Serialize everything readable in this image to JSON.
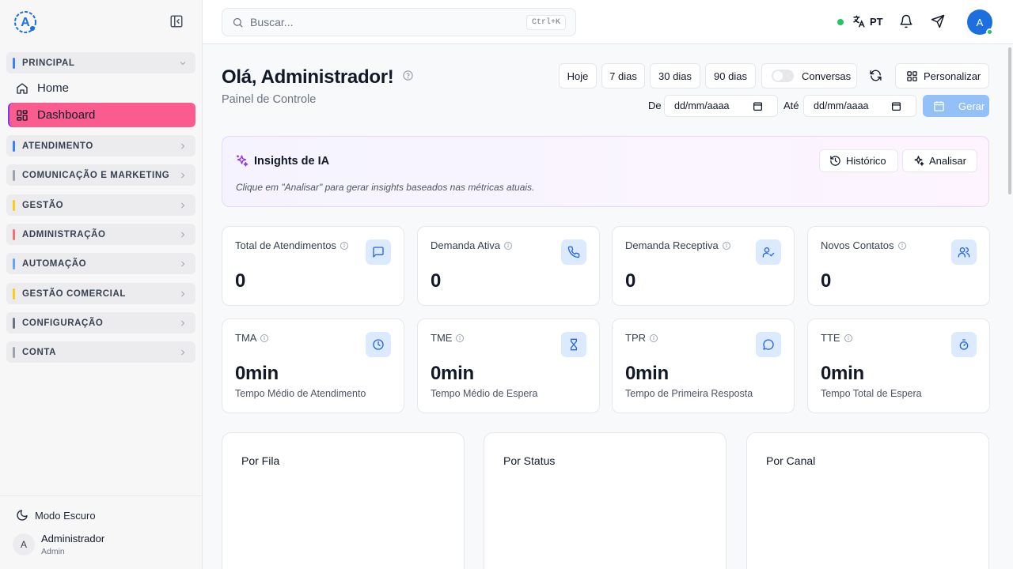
{
  "sidebar": {
    "sections": [
      {
        "label": "PRINCIPAL",
        "color": "#3b82f6"
      },
      {
        "label": "ATENDIMENTO",
        "color": "#3b82f6"
      },
      {
        "label": "COMUNICAÇÃO E MARKETING",
        "color": "#9ca3af"
      },
      {
        "label": "GESTÃO",
        "color": "#facc15"
      },
      {
        "label": "ADMINISTRAÇÃO",
        "color": "#f87171"
      },
      {
        "label": "AUTOMAÇÃO",
        "color": "#60a5fa"
      },
      {
        "label": "GESTÃO COMERCIAL",
        "color": "#facc15"
      },
      {
        "label": "CONFIGURAÇÃO",
        "color": "#6b7280"
      },
      {
        "label": "CONTA",
        "color": "#9ca3af"
      }
    ],
    "home_label": "Home",
    "dashboard_label": "Dashboard",
    "dark_mode_label": "Modo Escuro",
    "user": {
      "initial": "A",
      "name": "Administrador",
      "role": "Admin"
    }
  },
  "topbar": {
    "search_placeholder": "Buscar...",
    "shortcut": "Ctrl+K",
    "language": "PT",
    "avatar_initial": "A"
  },
  "header": {
    "title": "Olá, Administrador!",
    "subtitle": "Painel de Controle",
    "range_buttons": [
      "Hoje",
      "7 dias",
      "30 dias",
      "90 dias"
    ],
    "toggle_label": "Conversas",
    "customize_label": "Personalizar",
    "from_label": "De",
    "to_label": "Até",
    "date_placeholder": "dd/mm/aaaa",
    "generate_label": "Gerar"
  },
  "insights": {
    "title": "Insights de IA",
    "history_label": "Histórico",
    "analyze_label": "Analisar",
    "hint": "Clique em \"Analisar\" para gerar insights baseados nas métricas atuais."
  },
  "metrics_row1": [
    {
      "title": "Total de Atendimentos",
      "value": "0",
      "icon": "message-square-icon"
    },
    {
      "title": "Demanda Ativa",
      "value": "0",
      "icon": "phone-icon"
    },
    {
      "title": "Demanda Receptiva",
      "value": "0",
      "icon": "user-check-icon"
    },
    {
      "title": "Novos Contatos",
      "value": "0",
      "icon": "users-icon"
    }
  ],
  "metrics_row2": [
    {
      "title": "TMA",
      "value": "0min",
      "desc": "Tempo Médio de Atendimento",
      "icon": "clock-icon"
    },
    {
      "title": "TME",
      "value": "0min",
      "desc": "Tempo Médio de Espera",
      "icon": "hourglass-icon"
    },
    {
      "title": "TPR",
      "value": "0min",
      "desc": "Tempo de Primeira Resposta",
      "icon": "message-circle-icon"
    },
    {
      "title": "TTE",
      "value": "0min",
      "desc": "Tempo Total de Espera",
      "icon": "timer-icon"
    }
  ],
  "panels": [
    "Por Fila",
    "Por Status",
    "Por Canal"
  ],
  "colors": {
    "accent": "#fb5c8f",
    "primary": "#1d6fe0",
    "generate_disabled": "#93c0f7",
    "online": "#22c55e"
  }
}
